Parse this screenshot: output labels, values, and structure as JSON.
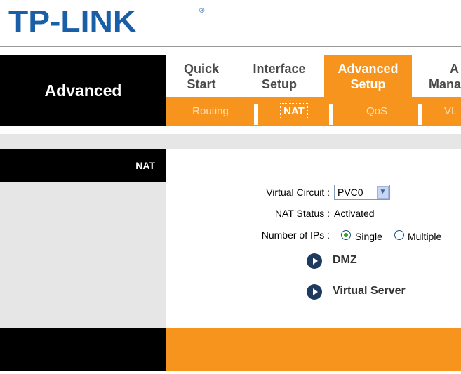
{
  "brand": {
    "logo": "TP-LINK",
    "reg": "®"
  },
  "header": {
    "title": "Advanced"
  },
  "tabs": [
    {
      "label": "Quick Start",
      "line1": "Quick",
      "line2": "Start"
    },
    {
      "label": "Interface Setup",
      "line1": "Interface",
      "line2": "Setup"
    },
    {
      "label": "Advanced Setup",
      "line1": "Advanced",
      "line2": "Setup"
    },
    {
      "label": "Access Management (partial)",
      "line1": "A",
      "line2": "Mana"
    }
  ],
  "subtabs": [
    {
      "label": "Routing"
    },
    {
      "label": "NAT"
    },
    {
      "label": "QoS"
    },
    {
      "label": "VL"
    }
  ],
  "section": {
    "title": "NAT"
  },
  "form": {
    "virtual_circuit_label": "Virtual Circuit :",
    "virtual_circuit_value": "PVC0",
    "nat_status_label": "NAT Status :",
    "nat_status_value": "Activated",
    "num_ips_label": "Number of IPs :",
    "option_single": "Single",
    "option_multiple": "Multiple"
  },
  "links": {
    "dmz": "DMZ",
    "virtual_server": "Virtual Server"
  },
  "colors": {
    "orange": "#f7941d",
    "logo_blue": "#1a5ea8",
    "black": "#000000",
    "grey": "#e6e6e6"
  }
}
